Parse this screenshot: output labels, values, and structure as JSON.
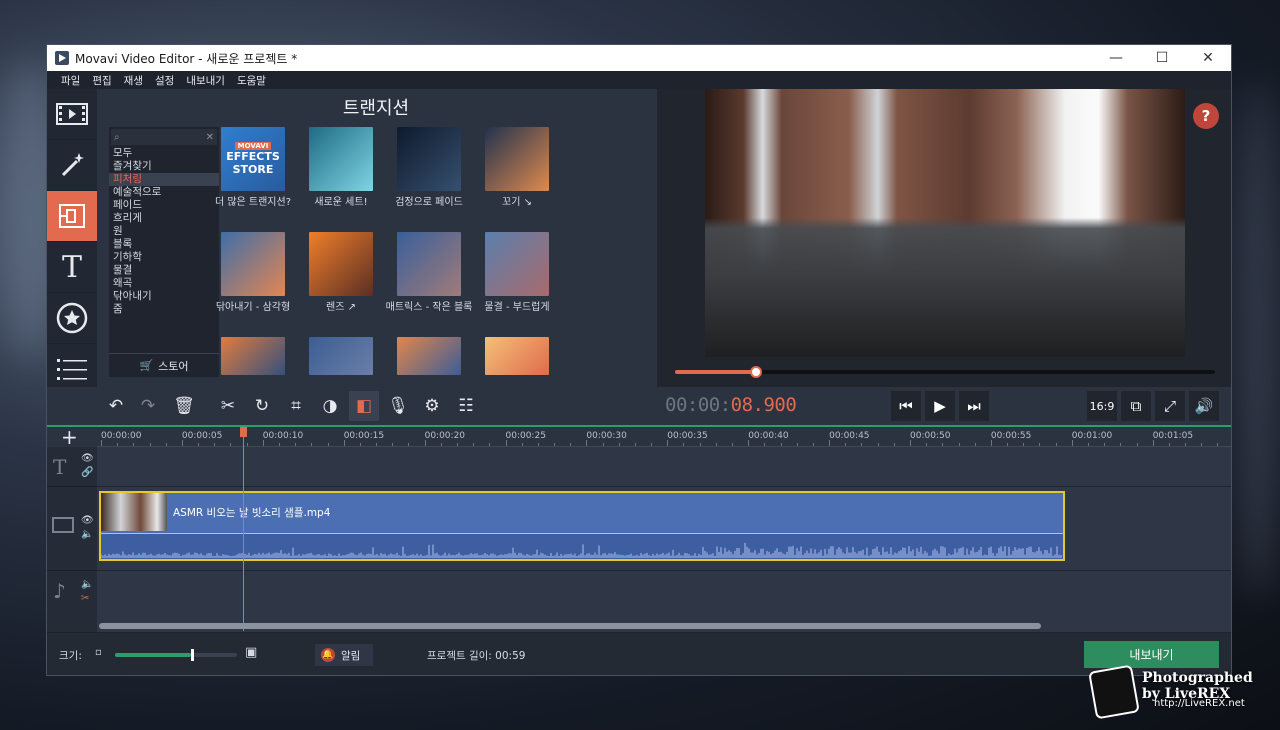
{
  "window": {
    "title": "Movavi Video Editor - 새로운 프로젝트 *",
    "controls": [
      "—",
      "☐",
      "✕"
    ]
  },
  "menu": [
    "파일",
    "편집",
    "재생",
    "설정",
    "내보내기",
    "도움말"
  ],
  "rail": [
    {
      "icon": "film-import-icon"
    },
    {
      "icon": "magic-wand-icon"
    },
    {
      "icon": "transitions-icon",
      "active": true
    },
    {
      "icon": "titles-icon",
      "glyph": "T"
    },
    {
      "icon": "stickers-icon"
    },
    {
      "icon": "more-list-icon"
    }
  ],
  "transitions": {
    "title": "트랜지션",
    "categories": [
      "모두",
      "즐겨찾기",
      "피처링",
      "예술적으로",
      "페이드",
      "흐리게",
      "원",
      "블록",
      "기하학",
      "물결",
      "왜곡",
      "닦아내기",
      "줌"
    ],
    "active_category": "피처링",
    "store_label": "스토어",
    "store_tile_text": [
      "MOVAVI",
      "EFFECTS",
      "STORE"
    ],
    "tiles": [
      {
        "label": "더 많은 트랜지션?",
        "colors": [
          "#2e7fd0",
          "#2a5b9e"
        ]
      },
      {
        "label": "새로운 세트!",
        "colors": [
          "#1e6b83",
          "#7fd5e3"
        ]
      },
      {
        "label": "검정으로 페이드",
        "colors": [
          "#0f1a2c",
          "#35506f"
        ]
      },
      {
        "label": "꼬기 ↘",
        "colors": [
          "#21324e",
          "#e08a4d"
        ]
      },
      {
        "label": "닦아내기 - 삼각형",
        "colors": [
          "#3f6ea8",
          "#e38652"
        ]
      },
      {
        "label": "렌즈 ↗",
        "colors": [
          "#f07e2a",
          "#5a2f24"
        ]
      },
      {
        "label": "매트릭스 - 작은 블록",
        "colors": [
          "#3a5f9a",
          "#a07b7a"
        ]
      },
      {
        "label": "물결 - 부드럽게",
        "colors": [
          "#5b7fad",
          "#a86b6c"
        ]
      },
      {
        "label": "",
        "colors": [
          "#e07c3e",
          "#35507d"
        ]
      },
      {
        "label": "",
        "colors": [
          "#3c5d93",
          "#6a7fa8"
        ]
      },
      {
        "label": "",
        "colors": [
          "#e0874b",
          "#3e5c96"
        ]
      },
      {
        "label": "",
        "colors": [
          "#f3c07a",
          "#e06b4a"
        ]
      }
    ]
  },
  "player": {
    "help": "?",
    "progress": 0.15,
    "timecode_dim": "00:00:",
    "timecode_live": "08.900",
    "aspect": "16:9"
  },
  "timeline": {
    "ticks": [
      "00:00:00",
      "00:00:05",
      "00:00:10",
      "00:00:15",
      "00:00:20",
      "00:00:25",
      "00:00:30",
      "00:00:35",
      "00:00:40",
      "00:00:45",
      "00:00:50",
      "00:00:55",
      "00:01:00",
      "00:01:05"
    ],
    "clip_name": "ASMR 비오는 날 빗소리 샘플.mp4"
  },
  "bottom": {
    "zoom_label": "크기:",
    "zoom_level": 0.62,
    "alert_label": "알림",
    "project_length": "프로젝트 길이: 00:59",
    "export_label": "내보내기"
  },
  "watermark": {
    "text": "Photographed by LiveREX",
    "url": "http://LiveREX.net"
  }
}
